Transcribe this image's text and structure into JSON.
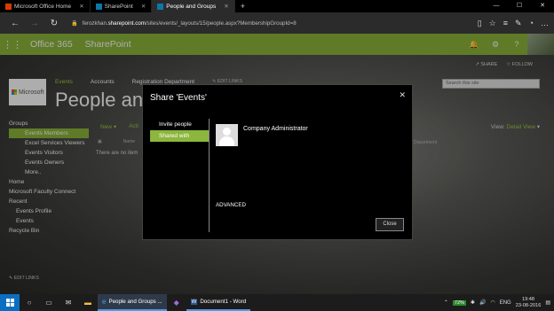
{
  "browser": {
    "tabs": [
      {
        "label": "Microsoft Office Home",
        "active": false
      },
      {
        "label": "SharePoint",
        "active": false
      },
      {
        "label": "People and Groups",
        "active": true
      }
    ],
    "new_tab": "+",
    "url_prefix": "ferozkhan.",
    "url_host": "sharepoint.com",
    "url_path": "/sites/events/_layouts/15/people.aspx?MembershipGroupId=8"
  },
  "suite": {
    "app_name": "Office 365",
    "site_name": "SharePoint"
  },
  "page": {
    "share_label": "SHARE",
    "follow_label": "FOLLOW",
    "top_nav": [
      "Events",
      "Accounts",
      "Registration Department"
    ],
    "edit_links": "EDIT LINKS",
    "search_placeholder": "Search this site",
    "logo_text": "Microsoft",
    "title": "People and G",
    "left_nav": {
      "groups": "Groups",
      "items": [
        "Events Members",
        "Excel Services Viewers",
        "Events Visitors",
        "Events Owners",
        "More.."
      ],
      "home": "Home",
      "faculty": "Microsoft Faculty Connect",
      "recent": "Recent",
      "recent_items": [
        "Events Profile",
        "Events"
      ],
      "recycle": "Recycle Bin",
      "edit_links": "EDIT LINKS"
    },
    "toolbar_new": "New",
    "toolbar_actions": "Acti",
    "no_items": "There are no item",
    "view_label": "View:",
    "view_value": "Detail View",
    "col_header": "Department",
    "name_col": "Name"
  },
  "dialog": {
    "title": "Share 'Events'",
    "side_items": [
      "Invite people",
      "Shared with"
    ],
    "member_name": "Company Administrator",
    "advanced": "ADVANCED",
    "close_button": "Close"
  },
  "taskbar": {
    "apps": [
      {
        "label": "People and Groups ...",
        "state": "open"
      },
      {
        "label": "Document1 - Word",
        "state": "run"
      }
    ],
    "battery": "72%",
    "language": "ENG",
    "time": "19:48",
    "date": "23-08-2016"
  },
  "colors": {
    "accent_green": "#8cb63c",
    "start_blue": "#0a6fc2"
  }
}
